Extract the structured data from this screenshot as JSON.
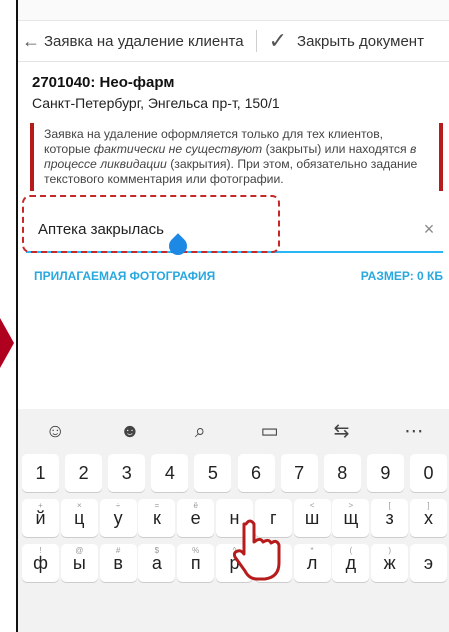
{
  "appbar": {
    "title": "Заявка на удаление клиента",
    "close_label": "Закрыть документ"
  },
  "client": {
    "name": "2701040: Нео-фарм",
    "address": "Санкт-Петербург, Энгельса пр-т, 150/1"
  },
  "note": {
    "p1": "Заявка на удаление оформляется только для тех клиентов, которые ",
    "em1": "фактически не существуют",
    "p2": " (закрыты) или находятся ",
    "em2": "в процессе ликвидации",
    "p3": " (закрытия). При этом, обязательно задание текстового комментария или фотографии."
  },
  "input": {
    "value": "Аптека закрылась",
    "clear_icon": "×"
  },
  "photo": {
    "label": "ПРИЛАГАЕМАЯ ФОТОГРАФИЯ",
    "size": "РАЗМЕР: 0 КБ"
  },
  "toolbar_icons": [
    "☺",
    "☻",
    "⌕",
    "▭",
    "⇆",
    "⋯"
  ],
  "rows": {
    "r1": [
      {
        "k": "1",
        "s": ""
      },
      {
        "k": "2",
        "s": ""
      },
      {
        "k": "3",
        "s": ""
      },
      {
        "k": "4",
        "s": ""
      },
      {
        "k": "5",
        "s": ""
      },
      {
        "k": "6",
        "s": ""
      },
      {
        "k": "7",
        "s": ""
      },
      {
        "k": "8",
        "s": ""
      },
      {
        "k": "9",
        "s": ""
      },
      {
        "k": "0",
        "s": ""
      }
    ],
    "r2": [
      {
        "k": "й",
        "s": "+"
      },
      {
        "k": "ц",
        "s": "×"
      },
      {
        "k": "у",
        "s": "÷"
      },
      {
        "k": "к",
        "s": "="
      },
      {
        "k": "е",
        "s": "ё"
      },
      {
        "k": "н",
        "s": ""
      },
      {
        "k": "г",
        "s": ""
      },
      {
        "k": "ш",
        "s": "<"
      },
      {
        "k": "щ",
        "s": ">"
      },
      {
        "k": "з",
        "s": "["
      },
      {
        "k": "х",
        "s": "]"
      }
    ],
    "r3": [
      {
        "k": "ф",
        "s": "!"
      },
      {
        "k": "ы",
        "s": "@"
      },
      {
        "k": "в",
        "s": "#"
      },
      {
        "k": "а",
        "s": "$"
      },
      {
        "k": "п",
        "s": "%"
      },
      {
        "k": "р",
        "s": "^"
      },
      {
        "k": "о",
        "s": "&"
      },
      {
        "k": "л",
        "s": "*"
      },
      {
        "k": "д",
        "s": "("
      },
      {
        "k": "ж",
        "s": ")"
      },
      {
        "k": "э",
        "s": ""
      }
    ]
  }
}
